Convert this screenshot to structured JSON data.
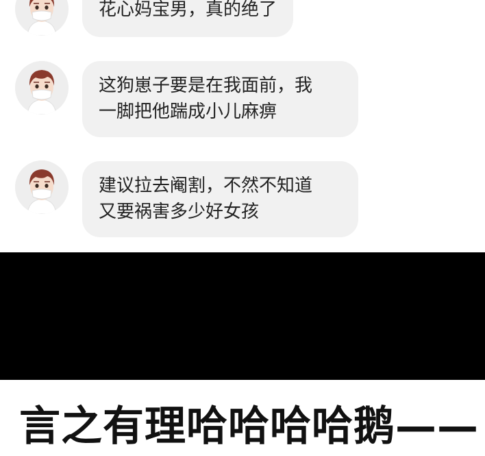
{
  "messages": [
    {
      "text_lines": [
        "花心妈宝男，真的绝了"
      ]
    },
    {
      "text_lines": [
        "这狗崽子要是在我面前，我",
        "一脚把他踹成小儿麻痹"
      ]
    },
    {
      "text_lines": [
        "建议拉去阉割，不然不知道",
        "又要祸害多少好女孩"
      ]
    }
  ],
  "caption": "言之有理哈哈哈哈鹅——",
  "colors": {
    "bubble": "#f1f1f1",
    "band": "#000000",
    "hair": "#8a3a2c",
    "skin": "#f6dccb",
    "mask": "#ffffff"
  },
  "icons": {
    "avatar": "user-avatar-masked-boy"
  }
}
